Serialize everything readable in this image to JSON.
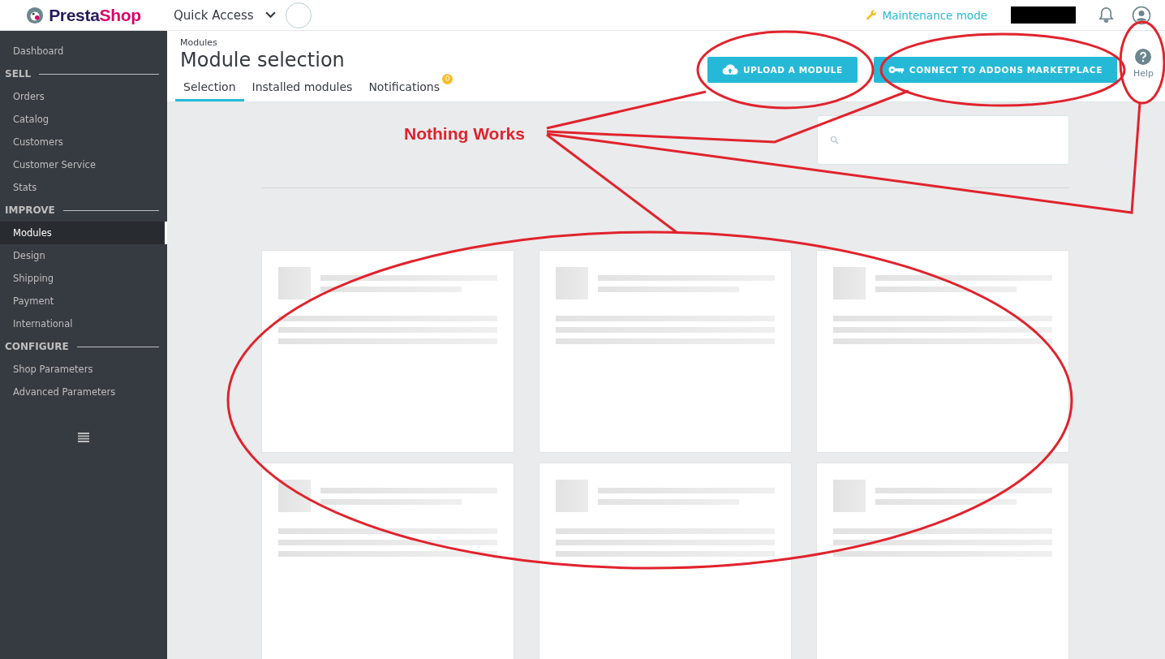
{
  "header": {
    "logo": [
      "Presta",
      "Shop"
    ],
    "quick_access": "Quick Access",
    "maintenance": "Maintenance mode",
    "user_name_redacted": true
  },
  "sidebar": {
    "items": [
      {
        "kind": "item",
        "label": "Dashboard",
        "selected": false
      },
      {
        "kind": "section",
        "label": "SELL"
      },
      {
        "kind": "item",
        "label": "Orders",
        "selected": false
      },
      {
        "kind": "item",
        "label": "Catalog",
        "selected": false
      },
      {
        "kind": "item",
        "label": "Customers",
        "selected": false
      },
      {
        "kind": "item",
        "label": "Customer Service",
        "selected": false
      },
      {
        "kind": "item",
        "label": "Stats",
        "selected": false
      },
      {
        "kind": "section",
        "label": "IMPROVE"
      },
      {
        "kind": "item",
        "label": "Modules",
        "selected": true
      },
      {
        "kind": "item",
        "label": "Design",
        "selected": false
      },
      {
        "kind": "item",
        "label": "Shipping",
        "selected": false
      },
      {
        "kind": "item",
        "label": "Payment",
        "selected": false
      },
      {
        "kind": "item",
        "label": "International",
        "selected": false
      },
      {
        "kind": "section",
        "label": "CONFIGURE"
      },
      {
        "kind": "item",
        "label": "Shop Parameters",
        "selected": false
      },
      {
        "kind": "item",
        "label": "Advanced Parameters",
        "selected": false
      }
    ]
  },
  "page": {
    "breadcrumb": "Modules",
    "title": "Module selection",
    "tabs": [
      {
        "label": "Selection",
        "selected": true
      },
      {
        "label": "Installed modules",
        "selected": false
      },
      {
        "label": "Notifications",
        "selected": false,
        "badge": "0"
      }
    ],
    "buttons": [
      "UPLOAD A MODULE",
      "CONNECT TO ADDONS MARKETPLACE"
    ],
    "help": "Help"
  },
  "module_list": {
    "loading": true
  },
  "annotation": {
    "text": "Nothing Works"
  }
}
